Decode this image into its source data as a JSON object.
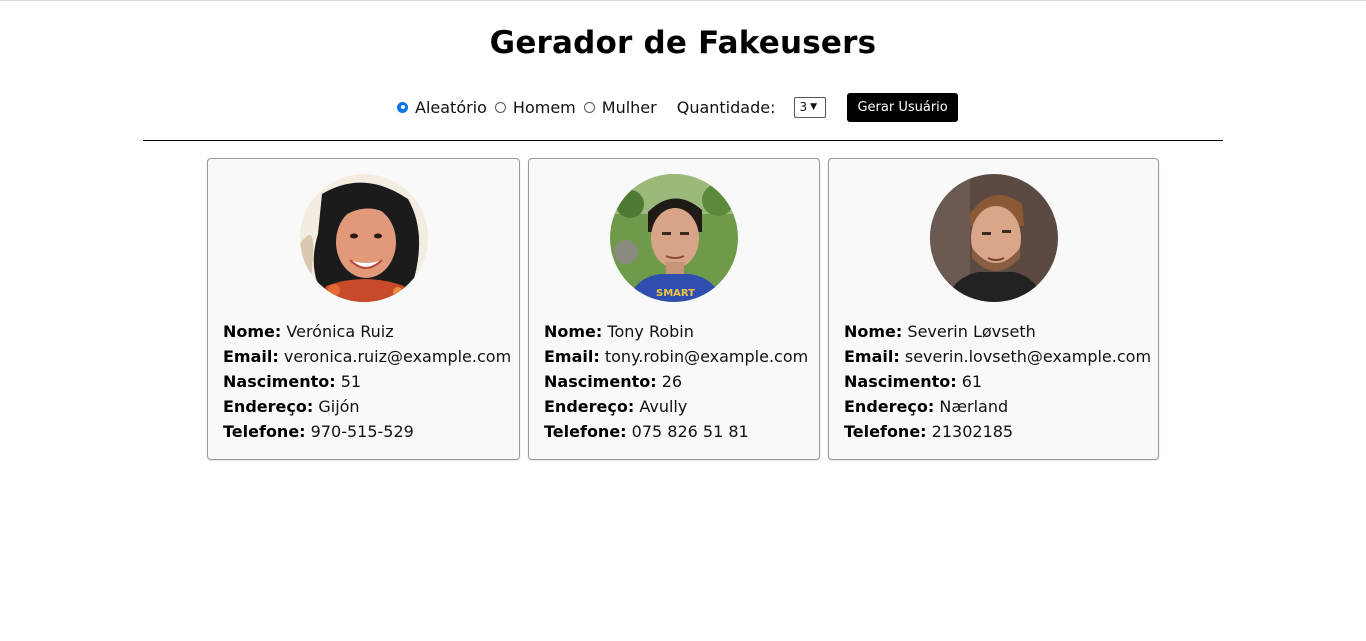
{
  "page": {
    "title": "Gerador de Fakeusers"
  },
  "controls": {
    "radios": [
      {
        "label": "Aleatório",
        "checked": true
      },
      {
        "label": "Homem",
        "checked": false
      },
      {
        "label": "Mulher",
        "checked": false
      }
    ],
    "quantity_label": "Quantidade:",
    "quantity_value": "3",
    "generate_button": "Gerar Usuário"
  },
  "field_labels": {
    "name": "Nome:",
    "email": "Email:",
    "birth": "Nascimento:",
    "address": "Endereço:",
    "phone": "Telefone:"
  },
  "users": [
    {
      "name": "Verónica Ruiz",
      "email": "veronica.ruiz@example.com",
      "birth": "51",
      "address": "Gijón",
      "phone": "970-515-529"
    },
    {
      "name": "Tony Robin",
      "email": "tony.robin@example.com",
      "birth": "26",
      "address": "Avully",
      "phone": "075 826 51 81"
    },
    {
      "name": "Severin Løvseth",
      "email": "severin.lovseth@example.com",
      "birth": "61",
      "address": "Nærland",
      "phone": "21302185"
    }
  ]
}
